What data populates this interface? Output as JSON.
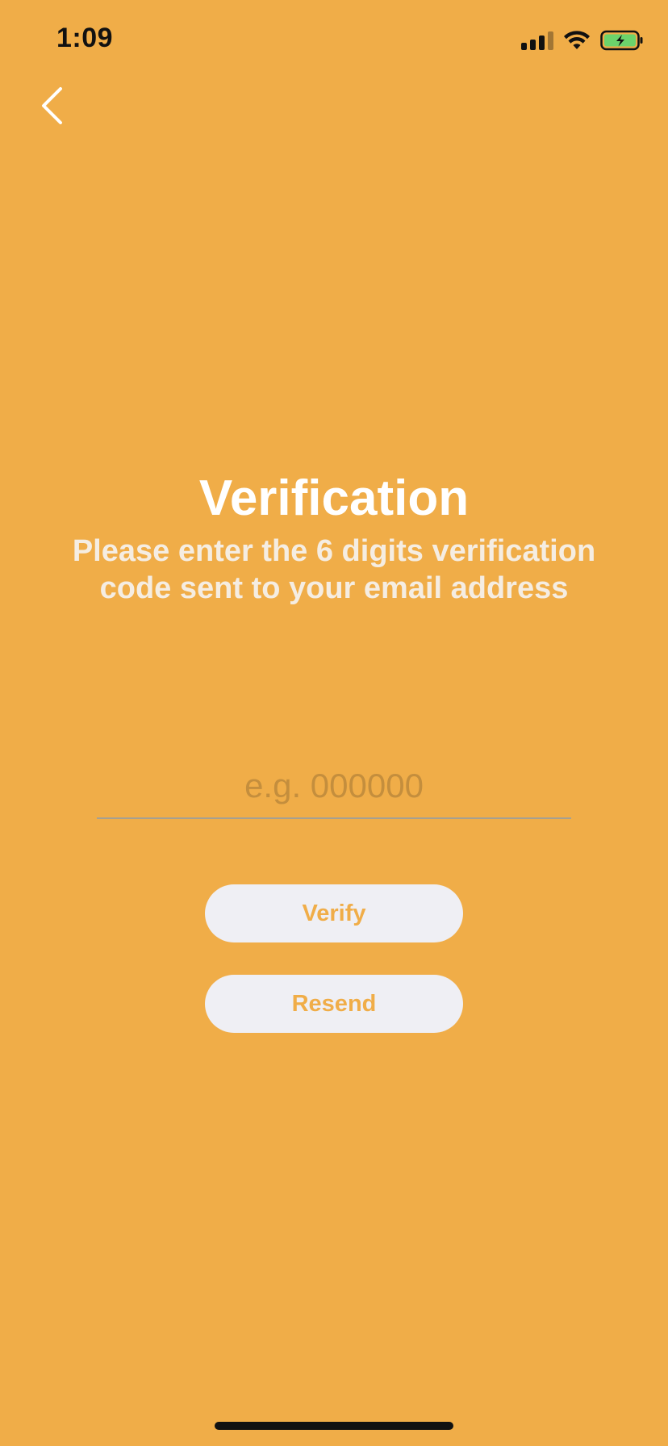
{
  "colors": {
    "background": "#F0AD48",
    "title": "#FFFFFF",
    "subtitle": "#F5EDE2",
    "button_background": "#EFEFF4",
    "button_text": "#F0AD48",
    "placeholder": "#C48E3D",
    "battery_fill": "#6CD36B"
  },
  "status_bar": {
    "time": "1:09",
    "icons": [
      "signal-icon",
      "wifi-icon",
      "battery-charging-icon"
    ]
  },
  "nav": {
    "back_icon": "chevron-left-icon"
  },
  "content": {
    "title": "Verification",
    "subtitle": "Please enter the 6 digits verification code sent to your email address"
  },
  "code_field": {
    "value": "",
    "placeholder": "e.g. 000000"
  },
  "buttons": {
    "verify_label": "Verify",
    "resend_label": "Resend"
  }
}
